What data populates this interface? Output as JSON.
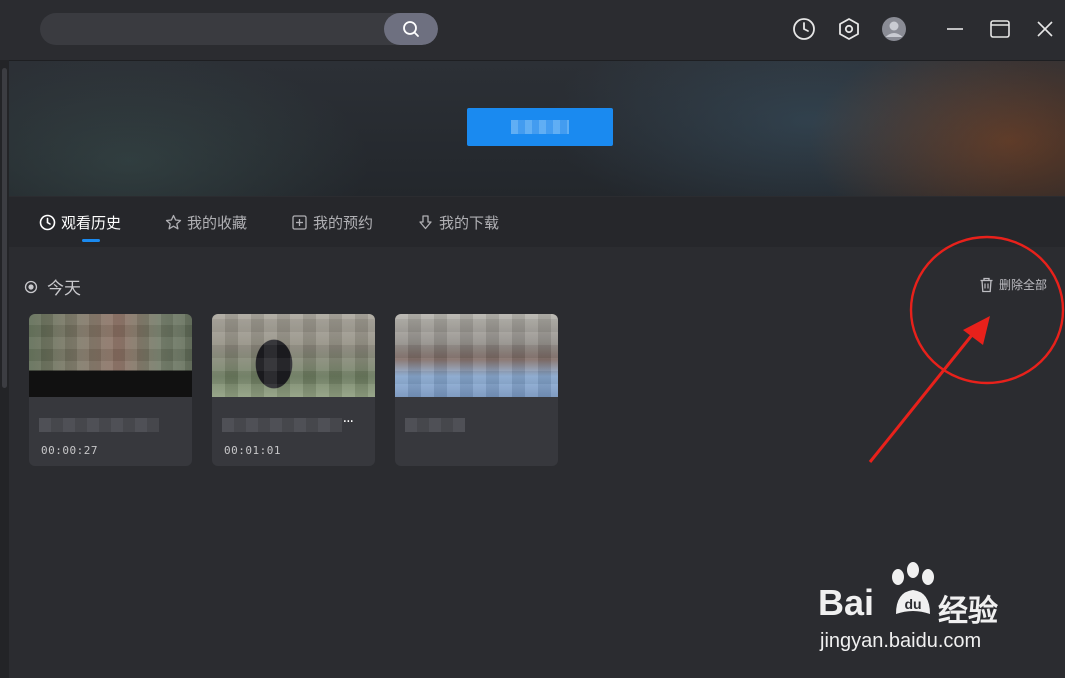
{
  "search": {
    "placeholder": "",
    "value": ""
  },
  "top_icons": [
    "search-icon",
    "history-clock-icon",
    "settings-hex-icon",
    "avatar-icon",
    "minimize-icon",
    "maximize-icon",
    "close-icon"
  ],
  "tabs": [
    {
      "label": "观看历史",
      "icon": "clock-icon",
      "active": true
    },
    {
      "label": "我的收藏",
      "icon": "star-icon",
      "active": false
    },
    {
      "label": "我的预约",
      "icon": "reserve-icon",
      "active": false
    },
    {
      "label": "我的下载",
      "icon": "download-icon",
      "active": false
    }
  ],
  "section": {
    "title": "今天",
    "delete_all": "删除全部"
  },
  "history": [
    {
      "duration": "00:00:27"
    },
    {
      "duration": "00:01:01",
      "more": "···"
    },
    {
      "duration": ""
    }
  ],
  "watermark": {
    "brand": "Bai",
    "brand_suffix": "经验",
    "url": "jingyan.baidu.com"
  },
  "colors": {
    "accent": "#1a8af0",
    "annotation": "#e8211b",
    "background": "#2b2c30"
  }
}
